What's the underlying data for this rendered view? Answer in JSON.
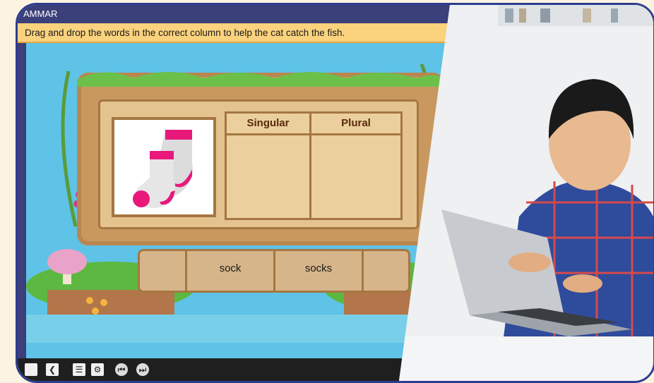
{
  "app": {
    "title": "AMMAR",
    "instruction": "Drag and drop the words in the correct column to help the cat catch the fish."
  },
  "board": {
    "columns": [
      "Singular",
      "Plural"
    ]
  },
  "words": [
    "sock",
    "socks"
  ],
  "toolbar": {
    "icons": [
      "square-icon",
      "back-arrow-icon",
      "list-icon",
      "wrench-icon",
      "previous-icon",
      "next-icon"
    ]
  },
  "colors": {
    "frame": "#2d3c8e",
    "title_bar": "#3b3f7a",
    "instruction_bar": "#fbd27d",
    "water": "#5ec3e6",
    "wood": "#c9985f",
    "column_header": "#5a2a0c",
    "sock_pink": "#e8197b"
  }
}
